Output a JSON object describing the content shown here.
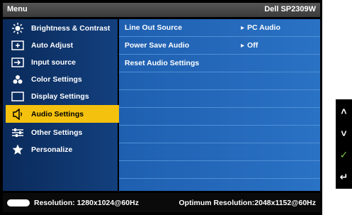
{
  "header": {
    "title": "Menu",
    "model": "Dell SP2309W"
  },
  "sidebar": {
    "items": [
      {
        "label": "Brightness & Contrast",
        "icon": "brightness-icon",
        "selected": false
      },
      {
        "label": "Auto Adjust",
        "icon": "auto-adjust-icon",
        "selected": false
      },
      {
        "label": "Input source",
        "icon": "input-source-icon",
        "selected": false
      },
      {
        "label": "Color Settings",
        "icon": "color-settings-icon",
        "selected": false
      },
      {
        "label": "Display Settings",
        "icon": "display-settings-icon",
        "selected": false
      },
      {
        "label": "Audio Settings",
        "icon": "speaker-icon",
        "selected": true
      },
      {
        "label": "Other Settings",
        "icon": "other-settings-icon",
        "selected": false
      },
      {
        "label": "Personalize",
        "icon": "star-icon",
        "selected": false
      }
    ]
  },
  "content": {
    "rows": [
      {
        "label": "Line Out Source",
        "value": "PC Audio"
      },
      {
        "label": "Power Save Audio",
        "value": "Off"
      },
      {
        "label": "Reset Audio Settings",
        "value": ""
      },
      {
        "label": "",
        "value": ""
      },
      {
        "label": "",
        "value": ""
      },
      {
        "label": "",
        "value": ""
      },
      {
        "label": "",
        "value": ""
      },
      {
        "label": "",
        "value": ""
      },
      {
        "label": "",
        "value": ""
      },
      {
        "label": "",
        "value": ""
      }
    ]
  },
  "footer": {
    "resolution": "Resolution: 1280x1024@60Hz",
    "optimum": "Optimum Resolution:2048x1152@60Hz"
  },
  "buttons": [
    {
      "icon": "up-arrow-icon",
      "glyph": "˄"
    },
    {
      "icon": "down-arrow-icon",
      "glyph": "˅"
    },
    {
      "icon": "checkmark-icon",
      "glyph": "✓",
      "color": "#7cc142"
    },
    {
      "icon": "back-icon",
      "glyph": "↵"
    }
  ]
}
